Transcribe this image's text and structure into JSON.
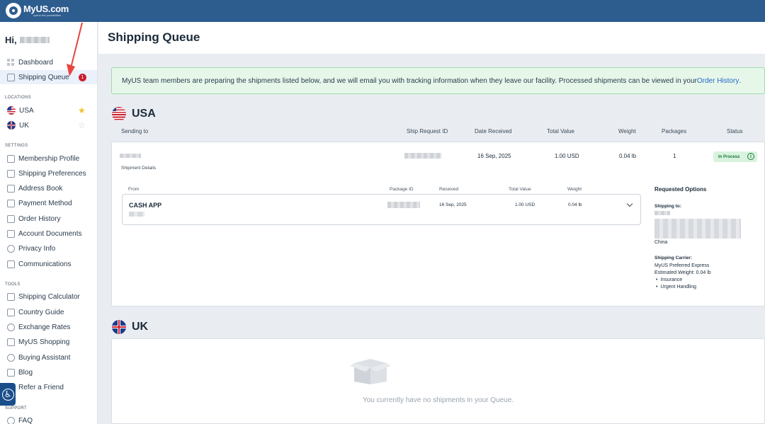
{
  "brand": {
    "name": "MyUS.com",
    "tagline": "option the possibilities"
  },
  "sidebar": {
    "greeting": "Hi,",
    "nav": [
      {
        "label": "Dashboard",
        "icon": "dashboard-icon"
      },
      {
        "label": "Shipping Queue",
        "icon": "shipping-queue-icon",
        "badge": "1",
        "active": true
      }
    ],
    "locations_label": "LOCATIONS",
    "locations": [
      {
        "label": "USA",
        "flag": "us-flag-icon",
        "favorite": true
      },
      {
        "label": "UK",
        "flag": "uk-flag-icon",
        "favorite": false
      }
    ],
    "settings_label": "SETTINGS",
    "settings": [
      "Membership Profile",
      "Shipping Preferences",
      "Address Book",
      "Payment Method",
      "Order History",
      "Account Documents",
      "Privacy Info",
      "Communications"
    ],
    "tools_label": "TOOLS",
    "tools": [
      "Shipping Calculator",
      "Country Guide",
      "Exchange Rates",
      "MyUS Shopping",
      "Buying Assistant",
      "Blog",
      "Refer a Friend"
    ],
    "support_label": "SUPPORT",
    "support": [
      "FAQ"
    ]
  },
  "page": {
    "title": "Shipping Queue",
    "banner": {
      "text": "MyUS team members are preparing the shipments listed below, and we will email you with tracking information when they leave our facility. Processed shipments can be viewed in your ",
      "link": "Order History",
      "suffix": "."
    }
  },
  "usa": {
    "title": "USA",
    "columns": {
      "sending_to": "Sending to",
      "ship_request_id": "Ship Request ID",
      "date_received": "Date Received",
      "total_value": "Total Value",
      "weight": "Weight",
      "packages": "Packages",
      "status": "Status"
    },
    "shipment": {
      "date_received": "16 Sep, 2025",
      "total_value": "1.00 USD",
      "weight": "0.04 lb",
      "packages": "1",
      "status": "In Process",
      "details_label": "Shipment Details",
      "package_columns": {
        "from": "From",
        "package_id": "Package ID",
        "received": "Received",
        "total_value": "Total Value",
        "weight": "Weight"
      },
      "package": {
        "from": "CASH APP",
        "received": "16 Sep, 2025",
        "total_value": "1.00 USD",
        "weight": "0.04 lb"
      },
      "options": {
        "title": "Requested Options",
        "shipping_to_label": "Shipping to:",
        "country": "China",
        "carrier_label": "Shipping Carrier:",
        "carrier": "MyUS Preferred Express",
        "estimated_weight": "Estimated Weight: 0.04 lb",
        "extras": [
          "Insurance",
          "Urgent Handling"
        ]
      }
    }
  },
  "uk": {
    "title": "UK",
    "empty_text": "You currently have no shipments in your Queue."
  },
  "colors": {
    "topbar": "#2d5c8f",
    "badge": "#c8202f",
    "banner_bg": "#e6f7ea",
    "status_bg": "#d9f3df",
    "link": "#2568c4"
  }
}
